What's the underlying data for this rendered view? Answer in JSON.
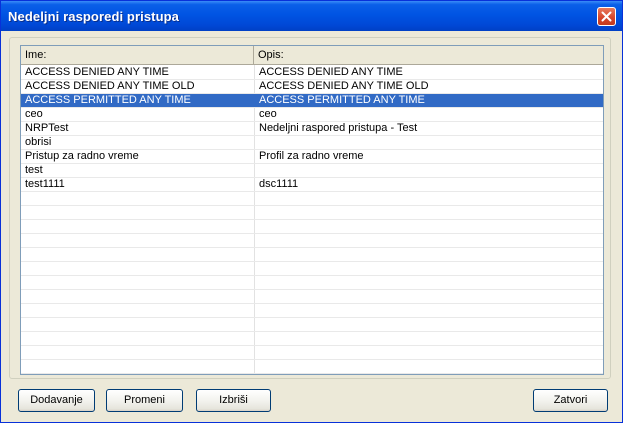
{
  "window": {
    "title": "Nedeljni rasporedi pristupa"
  },
  "list": {
    "columns": [
      "Ime:",
      "Opis:"
    ],
    "rows": [
      {
        "name": "ACCESS DENIED ANY TIME",
        "description": "ACCESS DENIED ANY TIME"
      },
      {
        "name": "ACCESS DENIED ANY TIME OLD",
        "description": "ACCESS DENIED ANY TIME OLD"
      },
      {
        "name": "ACCESS PERMITTED ANY TIME",
        "description": "ACCESS PERMITTED ANY TIME",
        "selected": true
      },
      {
        "name": "ceo",
        "description": "ceo"
      },
      {
        "name": "NRPTest",
        "description": "Nedeljni raspored pristupa - Test"
      },
      {
        "name": "obrisi",
        "description": ""
      },
      {
        "name": "Pristup za radno vreme",
        "description": "Profil za radno vreme"
      },
      {
        "name": "test",
        "description": ""
      },
      {
        "name": "test1111",
        "description": "dsc1111"
      },
      {
        "name": "",
        "description": ""
      },
      {
        "name": "",
        "description": ""
      },
      {
        "name": "",
        "description": ""
      },
      {
        "name": "",
        "description": ""
      },
      {
        "name": "",
        "description": ""
      },
      {
        "name": "",
        "description": ""
      },
      {
        "name": "",
        "description": ""
      },
      {
        "name": "",
        "description": ""
      },
      {
        "name": "",
        "description": ""
      },
      {
        "name": "",
        "description": ""
      },
      {
        "name": "",
        "description": ""
      },
      {
        "name": "",
        "description": ""
      },
      {
        "name": "",
        "description": ""
      }
    ]
  },
  "buttons": {
    "add": "Dodavanje",
    "edit": "Promeni",
    "delete": "Izbriši",
    "close": "Zatvori"
  },
  "colors": {
    "titlebar": "#0054E3",
    "selection": "#316AC5",
    "face": "#ECE9D8"
  }
}
